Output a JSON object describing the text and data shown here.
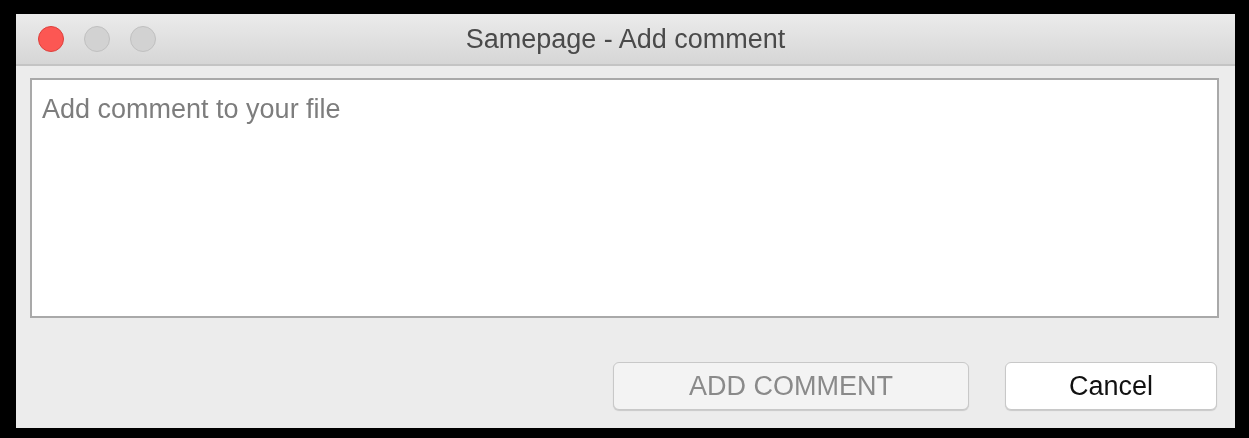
{
  "window": {
    "title": "Samepage - Add comment",
    "controls": [
      {
        "kind": "close",
        "disabled": false
      },
      {
        "kind": "minimize",
        "disabled": true
      },
      {
        "kind": "zoom",
        "disabled": true
      }
    ]
  },
  "comment": {
    "placeholder": "Add comment to your file"
  },
  "buttons": [
    {
      "label": "ADD COMMENT",
      "disabled": true
    },
    {
      "label": "Cancel",
      "disabled": false
    }
  ]
}
